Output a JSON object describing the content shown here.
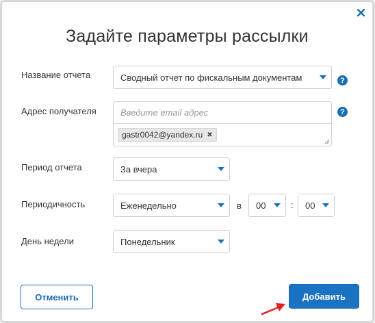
{
  "dialog": {
    "title": "Задайте параметры рассылки",
    "close_icon": "close-icon"
  },
  "fields": {
    "report_name": {
      "label": "Название отчета",
      "value": "Сводный отчет по фискальным документам"
    },
    "recipient": {
      "label": "Адрес получателя",
      "placeholder": "Введите email адрес",
      "tags": [
        "gastr0042@yandex.ru"
      ]
    },
    "period": {
      "label": "Период отчета",
      "value": "За вчера"
    },
    "frequency": {
      "label": "Периодичность",
      "value": "Еженедельно",
      "at_label": "в",
      "hour": "00",
      "colon": ":",
      "minute": "00"
    },
    "weekday": {
      "label": "День недели",
      "value": "Понедельник"
    }
  },
  "help_icon_text": "?",
  "buttons": {
    "cancel": "Отменить",
    "add": "Добавить"
  },
  "colors": {
    "accent": "#1a73c2",
    "annotation_arrow": "#e0201e"
  }
}
